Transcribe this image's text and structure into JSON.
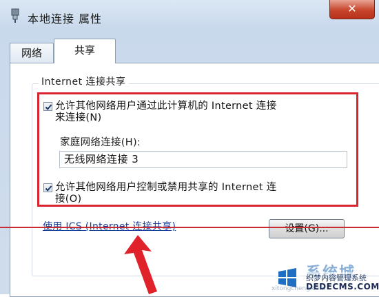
{
  "window": {
    "title": "本地连接 属性",
    "close_label": "✕"
  },
  "tabs": [
    {
      "label": "网络",
      "active": false
    },
    {
      "label": "共享",
      "active": true
    }
  ],
  "sharing": {
    "group_label": "Internet 连接共享",
    "allow_connect": {
      "checked": true,
      "line1": "允许其他网络用户通过此计算机的 Internet 连接",
      "line2": "来连接(N)"
    },
    "home_network_label": "家庭网络连接(H):",
    "home_network_value": "无线网络连接 3",
    "allow_control": {
      "checked": true,
      "line1": "允许其他网络用户控制或禁用共享的 Internet 连",
      "line2": "接(O)"
    },
    "ics_link": "使用 ICS (Internet 连接共享)",
    "settings_button": "设置(G)..."
  },
  "watermark": {
    "brand": "系统城",
    "tagline": "织梦内容管理系统",
    "site": "DEDECMS.COM",
    "url": "xitongcheng.com"
  },
  "colors": {
    "highlight_red": "#d9232e",
    "link_blue": "#1a3f9a",
    "close_red": "#c7452c"
  }
}
